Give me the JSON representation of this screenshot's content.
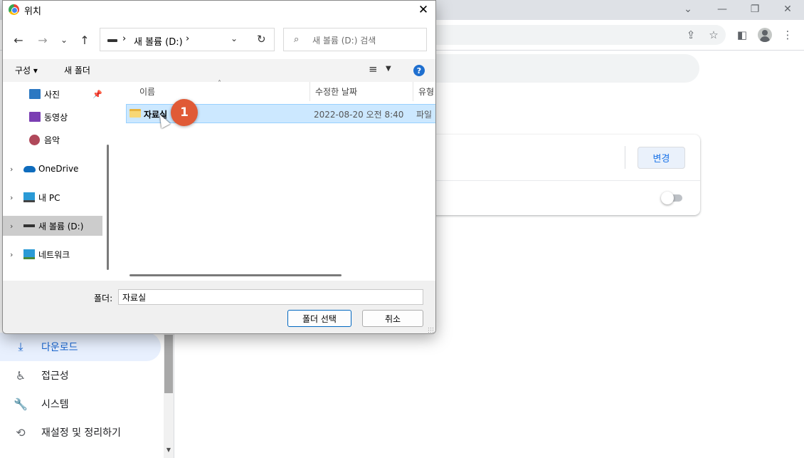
{
  "dialog": {
    "title": "위치",
    "close_glyph": "✕",
    "nav": {
      "back_glyph": "←",
      "forward_glyph": "→",
      "recent_glyph": "⌄",
      "up_glyph": "↑"
    },
    "address": {
      "separator": "›",
      "path": "새 볼륨 (D:)",
      "dropdown_glyph": "⌄",
      "refresh_glyph": "↻"
    },
    "search": {
      "placeholder": "새 볼륨 (D:) 검색",
      "icon_glyph": "⌕"
    },
    "commands": {
      "organize": "구성 ▾",
      "new_folder": "새 폴더",
      "view_glyph": "≡",
      "view_drop_glyph": "▼",
      "help_glyph": "?"
    },
    "nav_pane": {
      "items": [
        {
          "label": "사진",
          "icon": "pictures-icon",
          "pinned": true
        },
        {
          "label": "동영상",
          "icon": "videos-icon"
        },
        {
          "label": "음악",
          "icon": "music-icon"
        },
        {
          "label": "OneDrive",
          "icon": "onedrive-icon",
          "expandable": true
        },
        {
          "label": "내 PC",
          "icon": "this-pc-icon",
          "expandable": true
        },
        {
          "label": "새 볼륨 (D:)",
          "icon": "drive-icon",
          "expandable": true,
          "selected": true
        },
        {
          "label": "네트워크",
          "icon": "network-icon",
          "expandable": true
        }
      ],
      "chevron": "›",
      "pin_glyph": "📌"
    },
    "file_list": {
      "columns": [
        "이름",
        "수정한 날짜",
        "유형"
      ],
      "sort_glyph": "˄",
      "rows": [
        {
          "name": "자료실",
          "modified": "2022-08-20 오전 8:40",
          "type": "파일"
        }
      ]
    },
    "step_badge": "1",
    "folder_field": {
      "label": "폴더:",
      "value": "자료실"
    },
    "buttons": {
      "select": "폴더 선택",
      "cancel": "취소"
    }
  },
  "browser": {
    "window_controls": {
      "tabs_menu": "⌄",
      "minimize": "—",
      "restore": "❐",
      "close": "✕"
    },
    "toolbar_glyphs": {
      "share": "⇪",
      "bookmark": "☆",
      "side_panel": "◧",
      "menu": "⋮"
    },
    "settings_card": {
      "change_button": "변경"
    },
    "sidebar": {
      "items": [
        {
          "label": "다운로드",
          "icon": "download-icon",
          "glyph": "⤓",
          "active": true
        },
        {
          "label": "접근성",
          "icon": "accessibility-icon",
          "glyph": "♿"
        },
        {
          "label": "시스템",
          "icon": "wrench-icon",
          "glyph": "🔧"
        },
        {
          "label": "재설정 및 정리하기",
          "icon": "history-icon",
          "glyph": "⟲"
        }
      ],
      "scroll_arrow": "▼"
    }
  },
  "colors": {
    "accent": "#1a73e8",
    "selection": "#cce8ff",
    "badge": "#e05a36"
  }
}
